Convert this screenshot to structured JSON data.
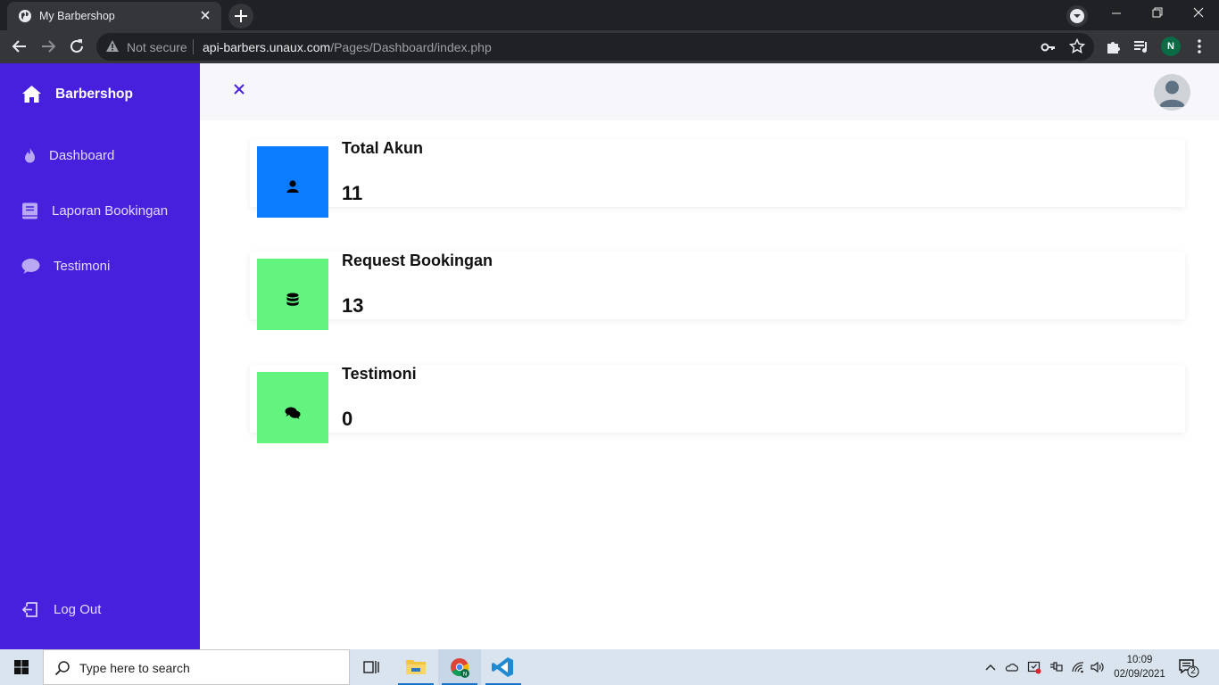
{
  "browser": {
    "tab_title": "My Barbershop",
    "security_label": "Not secure",
    "url_host": "api-barbers.unaux.com",
    "url_path": "/Pages/Dashboard/index.php",
    "profile_initial": "N"
  },
  "sidebar": {
    "brand": "Barbershop",
    "items": [
      {
        "label": "Dashboard",
        "icon": "fire-icon"
      },
      {
        "label": "Laporan Bookingan",
        "icon": "book-icon"
      },
      {
        "label": "Testimoni",
        "icon": "comment-icon"
      }
    ],
    "logout": "Log Out"
  },
  "cards": [
    {
      "title": "Total Akun",
      "value": "11",
      "icon": "user-icon",
      "color": "#0b7cff"
    },
    {
      "title": "Request Bookingan",
      "value": "13",
      "icon": "database-icon",
      "color": "#62f47e"
    },
    {
      "title": "Testimoni",
      "value": "0",
      "icon": "comments-icon",
      "color": "#62f47e"
    }
  ],
  "colors": {
    "sidebar": "#4720dd",
    "topbar": "#f6f6fb"
  },
  "taskbar": {
    "search_placeholder": "Type here to search",
    "time": "10:09",
    "date": "02/09/2021",
    "notification_count": "2"
  }
}
